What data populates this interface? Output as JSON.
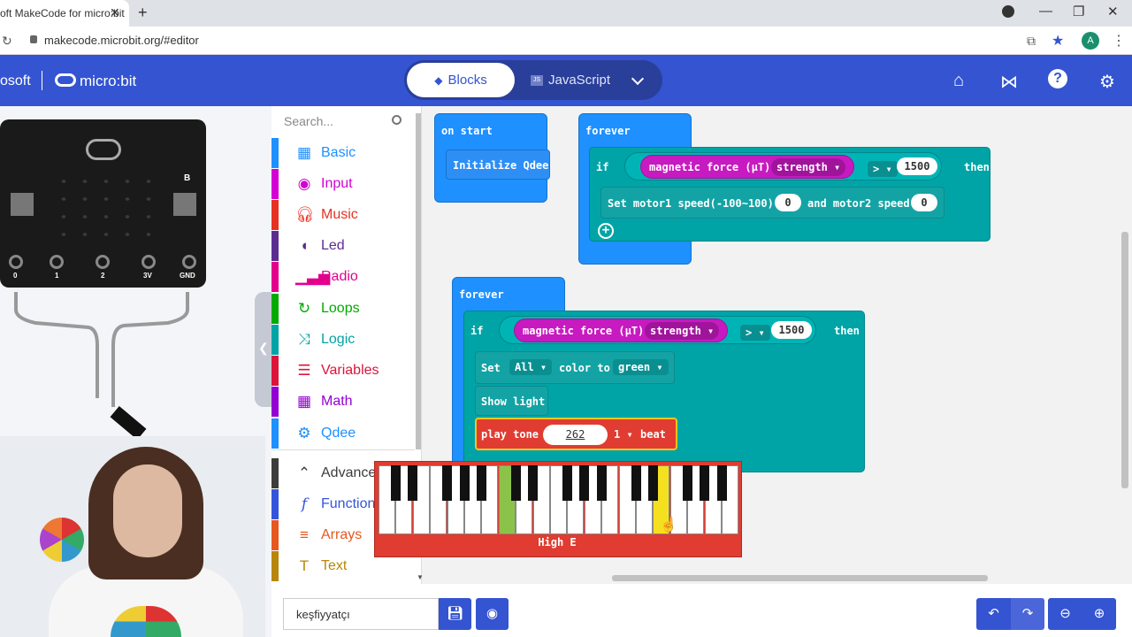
{
  "browser": {
    "tab_title": "oft MakeCode for micro:bit",
    "tab_close": "✕",
    "new_tab": "+",
    "url": "makecode.microbit.org/#editor",
    "avatar": "A"
  },
  "header": {
    "brand": "osoft",
    "product": "micro:bit",
    "blocks_label": "Blocks",
    "javascript_label": "JavaScript"
  },
  "simulator": {
    "pins": [
      "0",
      "1",
      "2",
      "3V",
      "GND"
    ],
    "button_b": "B"
  },
  "toolbox": {
    "search_placeholder": "Search...",
    "categories": [
      {
        "label": "Basic",
        "color": "#1e90ff",
        "icon": "grid-icon"
      },
      {
        "label": "Input",
        "color": "#d400d4",
        "icon": "target-icon"
      },
      {
        "label": "Music",
        "color": "#e63022",
        "icon": "headphones-icon"
      },
      {
        "label": "Led",
        "color": "#5c2d91",
        "icon": "toggle-icon"
      },
      {
        "label": "Radio",
        "color": "#e3008c",
        "icon": "signal-icon"
      },
      {
        "label": "Loops",
        "color": "#00aa00",
        "icon": "loop-icon"
      },
      {
        "label": "Logic",
        "color": "#00a4a6",
        "icon": "shuffle-icon"
      },
      {
        "label": "Variables",
        "color": "#dc143c",
        "icon": "list-icon"
      },
      {
        "label": "Math",
        "color": "#9400d3",
        "icon": "calculator-icon"
      },
      {
        "label": "Qdee",
        "color": "#1e90ff",
        "icon": "gear-icon"
      },
      {
        "label": "Advanced",
        "color": "#3c3c3c",
        "icon": "chevron-up-icon"
      },
      {
        "label": "Functions",
        "color": "#3455db",
        "icon": "function-icon"
      },
      {
        "label": "Arrays",
        "color": "#e65722",
        "icon": "arrays-icon"
      },
      {
        "label": "Text",
        "color": "#b8860b",
        "icon": "text-icon"
      }
    ]
  },
  "workspace": {
    "on_start": "on start",
    "init_qdee": "Initialize Qdee",
    "forever1": {
      "label": "forever",
      "if": "if",
      "sensor": "magnetic force (µT)",
      "axis": "strength",
      "op": ">",
      "value": "1500",
      "then": "then",
      "action": "Set motor1 speed(-100~100)",
      "m1": "0",
      "and": "and motor2 speed",
      "m2": "0"
    },
    "forever2": {
      "label": "forever",
      "if": "if",
      "sensor": "magnetic force (µT)",
      "axis": "strength",
      "op": ">",
      "value": "1500",
      "then": "then",
      "set": "Set",
      "all": "All",
      "color_to": "color to",
      "color": "green",
      "show": "Show light",
      "play_tone": "play tone",
      "tone_value": "262",
      "beat": "1",
      "beat_label": "beat"
    }
  },
  "piano": {
    "note_label": "High E"
  },
  "bottom": {
    "project_name": "keşfiyyatçı"
  }
}
